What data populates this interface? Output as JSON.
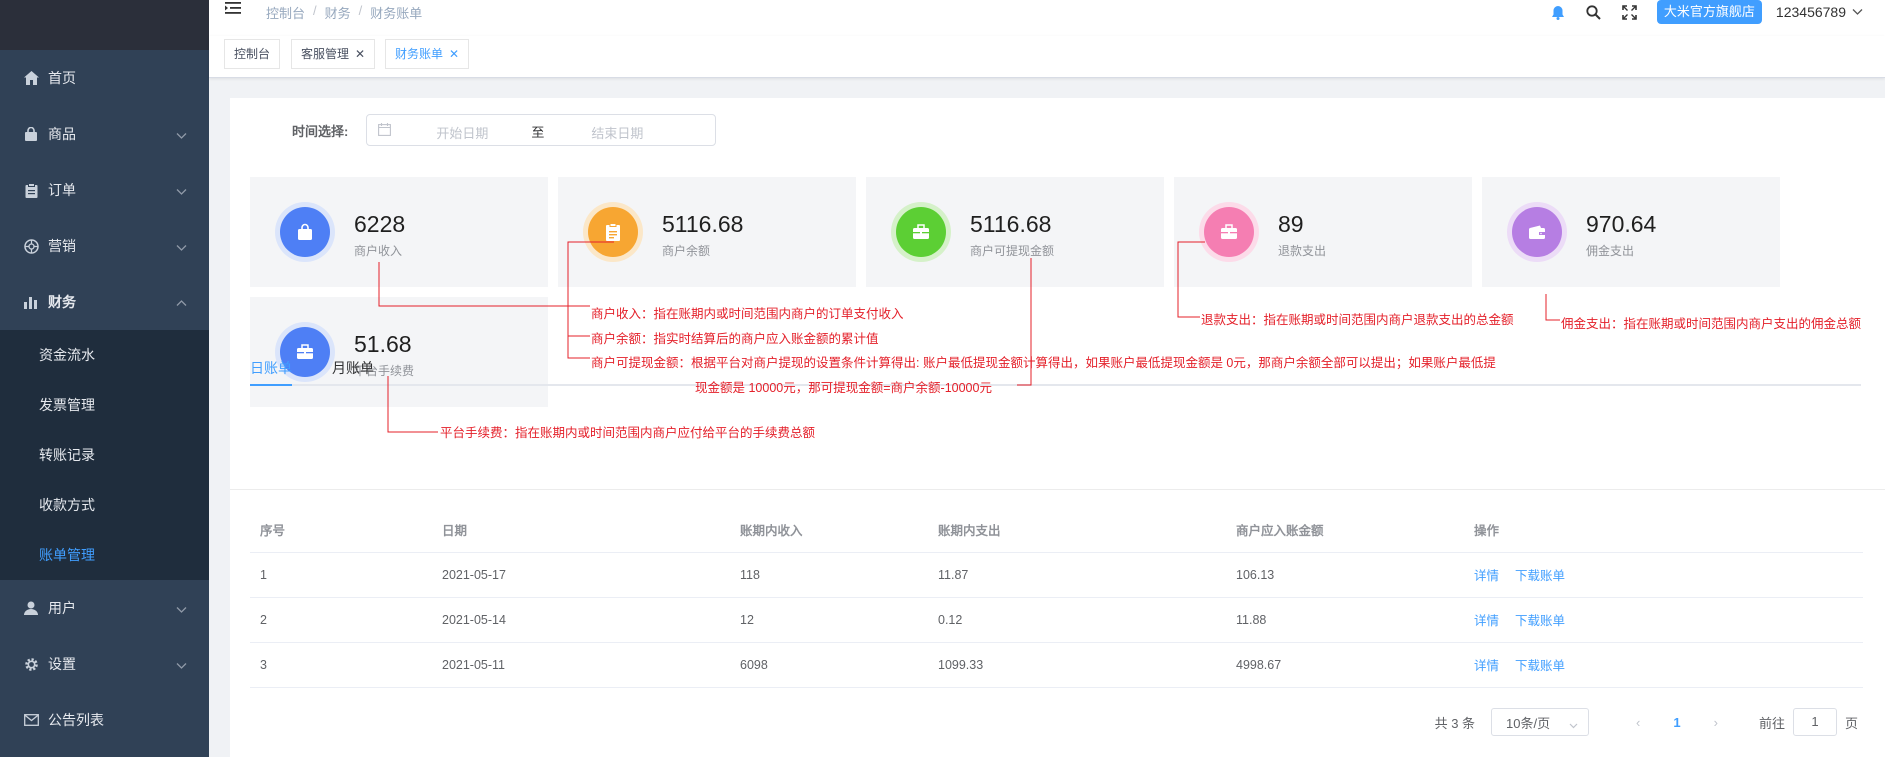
{
  "sidebar": {
    "items": [
      {
        "label": "首页",
        "icon": "home-icon"
      },
      {
        "label": "商品",
        "icon": "bag-icon"
      },
      {
        "label": "订单",
        "icon": "clipboard-icon"
      },
      {
        "label": "营销",
        "icon": "aperture-icon"
      },
      {
        "label": "财务",
        "icon": "bar-chart-icon"
      }
    ],
    "finance_sub": [
      "资金流水",
      "发票管理",
      "转账记录",
      "收款方式",
      "账单管理"
    ],
    "items_after": [
      {
        "label": "用户",
        "icon": "user-icon"
      },
      {
        "label": "设置",
        "icon": "gear-icon"
      },
      {
        "label": "公告列表",
        "icon": "mail-icon"
      }
    ]
  },
  "navbar": {
    "breadcrumb": [
      "控制台",
      "财务",
      "财务账单"
    ],
    "store": "大米官方旗舰店",
    "username": "123456789"
  },
  "tags": [
    "控制台",
    "客服管理",
    "财务账单"
  ],
  "filter": {
    "label": "时间选择:",
    "start_placeholder": "开始日期",
    "to": "至",
    "end_placeholder": "结束日期"
  },
  "stats": [
    {
      "value": "6228",
      "label": "商户收入",
      "color": "#4e7ff5",
      "icon": "shopping-bag-icon"
    },
    {
      "value": "5116.68",
      "label": "商户余额",
      "color": "#f7a632",
      "icon": "document-icon"
    },
    {
      "value": "5116.68",
      "label": "商户可提现金额",
      "color": "#5ccf34",
      "icon": "briefcase-icon"
    },
    {
      "value": "89",
      "label": "退款支出",
      "color": "#f57eb2",
      "icon": "briefcase-icon"
    },
    {
      "value": "970.64",
      "label": "佣金支出",
      "color": "#b67ee3",
      "icon": "wallet-icon"
    },
    {
      "value": "51.68",
      "label": "平台手续费",
      "color": "#4e7ff5",
      "icon": "briefcase-icon"
    }
  ],
  "tabs": [
    "日账单",
    "月账单"
  ],
  "table": {
    "headers": [
      "序号",
      "日期",
      "账期内收入",
      "账期内支出",
      "商户应入账金额",
      "操作"
    ],
    "rows": [
      [
        "1",
        "2021-05-17",
        "118",
        "11.87",
        "106.13"
      ],
      [
        "2",
        "2021-05-14",
        "12",
        "0.12",
        "11.88"
      ],
      [
        "3",
        "2021-05-11",
        "6098",
        "1099.33",
        "4998.67"
      ]
    ],
    "actions": [
      "详情",
      "下载账单"
    ]
  },
  "pagination": {
    "total": "共 3 条",
    "page_size": "10条/页",
    "current": "1",
    "goto": "前往",
    "goto_value": "1",
    "page_unit": "页"
  },
  "annotations": [
    "商户收入：指在账期内或时间范围内商户的订单支付收入",
    "商户余额：指实时结算后的商户应入账金额的累计值",
    "商户可提现金额：根据平台对商户提现的设置条件计算得出: 账户最低提现金额计算得出，如果账户最低提现金额是 0元，那商户余额全部可以提出；如果账户最低提",
    "现金额是 10000元，那可提现金额=商户余额-10000元",
    "退款支出：指在账期或时间范围内商户退款支出的总金额",
    "佣金支出：指在账期或时间范围内商户支出的佣金总额",
    "平台手续费：指在账期内或时间范围内商户应付给平台的手续费总额"
  ],
  "colors": {
    "sidebar": "#304156",
    "submenu": "#1f2d3d",
    "accent": "#409eff",
    "annotation": "#e4202a"
  }
}
